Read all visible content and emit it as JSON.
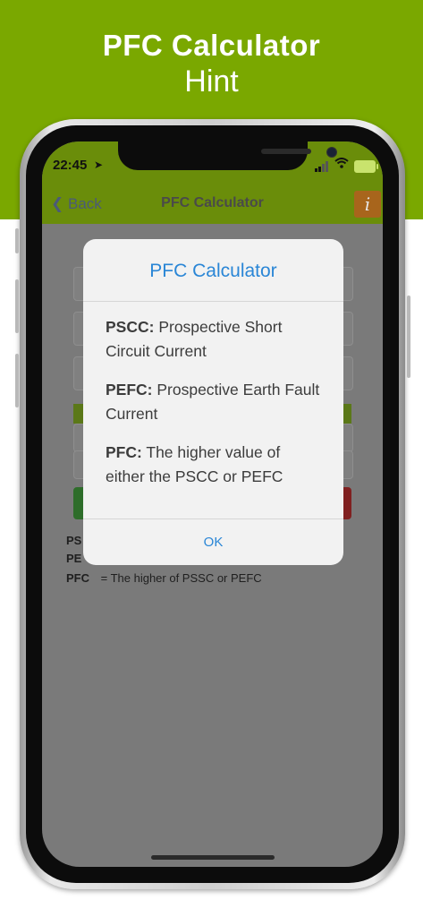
{
  "banner": {
    "title": "PFC Calculator",
    "subtitle": "Hint"
  },
  "status_bar": {
    "time": "22:45"
  },
  "navbar": {
    "back_label": "Back",
    "title": "PFC Calculator",
    "info_label": "i"
  },
  "legend": {
    "rows": [
      {
        "abbr": "PS",
        "text": ""
      },
      {
        "abbr": "PE",
        "text": ""
      },
      {
        "abbr": "PFC",
        "text": "= The higher of PSSC or PEFC"
      }
    ]
  },
  "alert": {
    "title": "PFC Calculator",
    "paragraphs": [
      {
        "term": "PSCC:",
        "text": " Prospective Short Circuit Current"
      },
      {
        "term": "PEFC:",
        "text": " Prospective Earth Fault Current"
      },
      {
        "term": "PFC:",
        "text": " The higher value of either the PSCC or PEFC"
      }
    ],
    "ok_label": "OK"
  },
  "icons": {
    "back": "chevron-left-icon",
    "location": "location-arrow-icon",
    "signal": "signal-icon",
    "wifi": "wifi-icon",
    "battery": "battery-charging-icon",
    "info": "info-icon"
  },
  "colors": {
    "banner": "#7aa800",
    "navbar": "#6a8d0a",
    "info_button": "#a8651c",
    "alert_accent": "#2a86d6"
  }
}
